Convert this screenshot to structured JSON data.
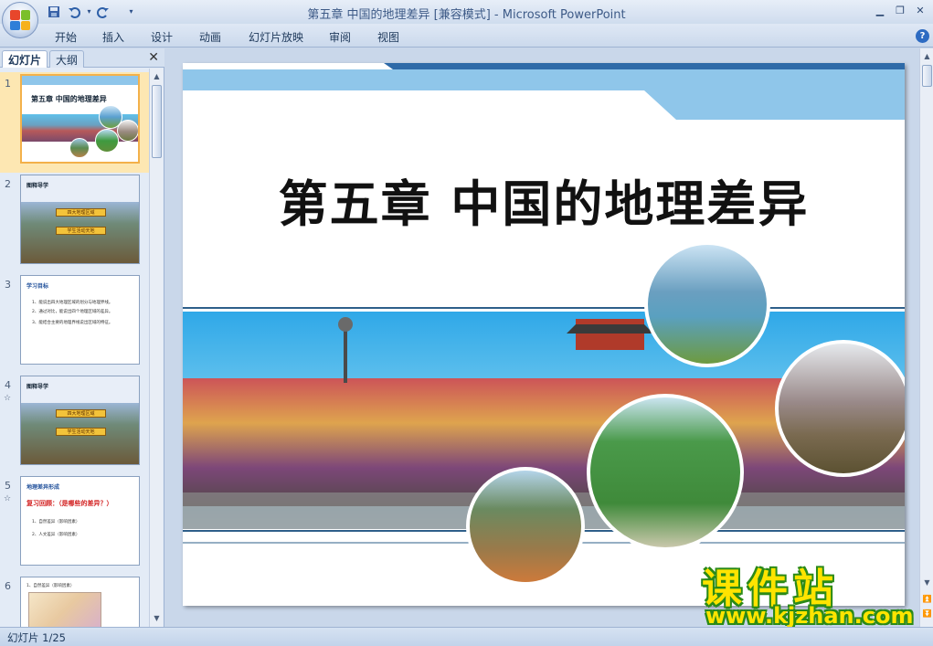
{
  "window": {
    "title": "第五章  中国的地理差异 [兼容模式] - Microsoft PowerPoint"
  },
  "ribbon": {
    "tabs": [
      "开始",
      "插入",
      "设计",
      "动画",
      "幻灯片放映",
      "审阅",
      "视图"
    ]
  },
  "left_pane": {
    "tabs": [
      "幻灯片",
      "大纲"
    ],
    "close_icon": "close-icon",
    "slides": [
      {
        "number": "1",
        "title": "第五章  中国的地理差异",
        "selected": true
      },
      {
        "number": "2",
        "title": "图释导学",
        "buttons": [
          "四大地理区域",
          "学生活动天地"
        ]
      },
      {
        "number": "3",
        "title": "学习目标",
        "lines": [
          "1、能说出四大地理区域的划分与地理界线。",
          "2、通过对比，能说出四个地理区域的差异。",
          "3、能结合主要的地理界线说出区域的特征。"
        ]
      },
      {
        "number": "4",
        "anim": "☆",
        "title": "图释导学",
        "buttons": [
          "四大地理区域",
          "学生活动天地"
        ]
      },
      {
        "number": "5",
        "anim": "☆",
        "title": "地理差异形成",
        "red": "复习回顾：（是哪些的差异？）",
        "lines": [
          "1、自然差异（影响因素）",
          "2、人文差异（影响因素）"
        ]
      },
      {
        "number": "6",
        "lines": [
          "1、自然差异（影响因素）"
        ]
      }
    ]
  },
  "slide": {
    "title": "第五章  中国的地理差异"
  },
  "watermark": {
    "cn": "课件站",
    "url": "www.kjzhan.com"
  },
  "status": {
    "text": "幻灯片 1/25"
  },
  "colors": {
    "ribbon_bg": "#cbd9ec",
    "slide_band": "#8fc6ea",
    "slide_band_dark": "#2e6aa8",
    "selection": "#fde7b2"
  }
}
